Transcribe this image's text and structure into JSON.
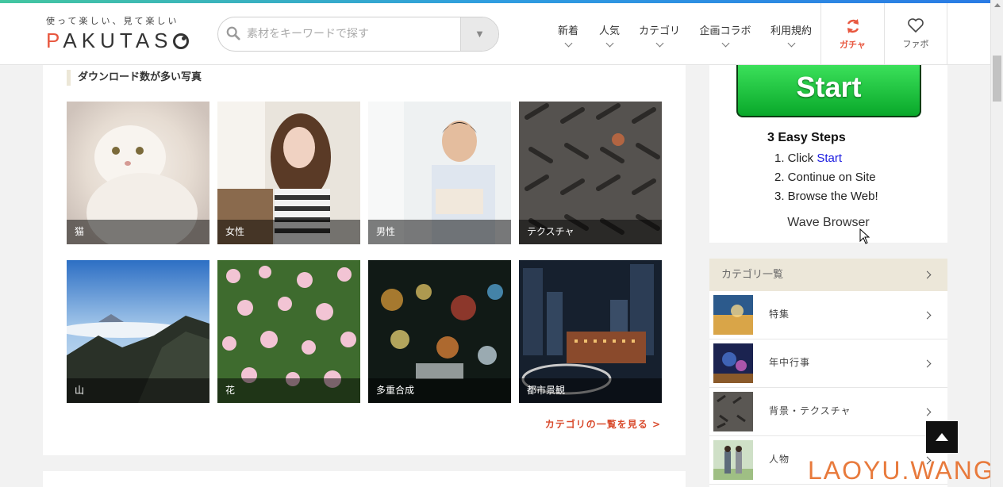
{
  "header": {
    "logo_tagline": "使って楽しい、見て楽しい",
    "logo_word": "PAKUTASO",
    "search": {
      "placeholder": "素材をキーワードで探す"
    },
    "nav": [
      {
        "label": "新着"
      },
      {
        "label": "人気"
      },
      {
        "label": "カテゴリ"
      },
      {
        "label": "企画コラボ"
      },
      {
        "label": "利用規約"
      }
    ],
    "gacha_label": "ガチャ",
    "fav_label": "ファボ",
    "accent_color": "#e8573f"
  },
  "main": {
    "section_title": "ダウンロード数が多い写真",
    "photos": [
      {
        "caption": "猫"
      },
      {
        "caption": "女性"
      },
      {
        "caption": "男性"
      },
      {
        "caption": "テクスチャ"
      },
      {
        "caption": "山"
      },
      {
        "caption": "花"
      },
      {
        "caption": "多重合成"
      },
      {
        "caption": "都市景観"
      }
    ],
    "more_link": "カテゴリの一覧を見る >"
  },
  "ad": {
    "button": "Start",
    "steps_title": "3 Easy Steps",
    "step1_prefix": "1. Click ",
    "step1_link": "Start",
    "step2": "2. Continue on Site",
    "step3": "3. Browse the Web!",
    "brand": "Wave Browser"
  },
  "sidebar": {
    "category_header": "カテゴリ一覧",
    "categories": [
      {
        "label": "特集"
      },
      {
        "label": "年中行事"
      },
      {
        "label": "背景・テクスチャ"
      },
      {
        "label": "人物"
      }
    ]
  },
  "watermark": "LAOYU.WANG"
}
